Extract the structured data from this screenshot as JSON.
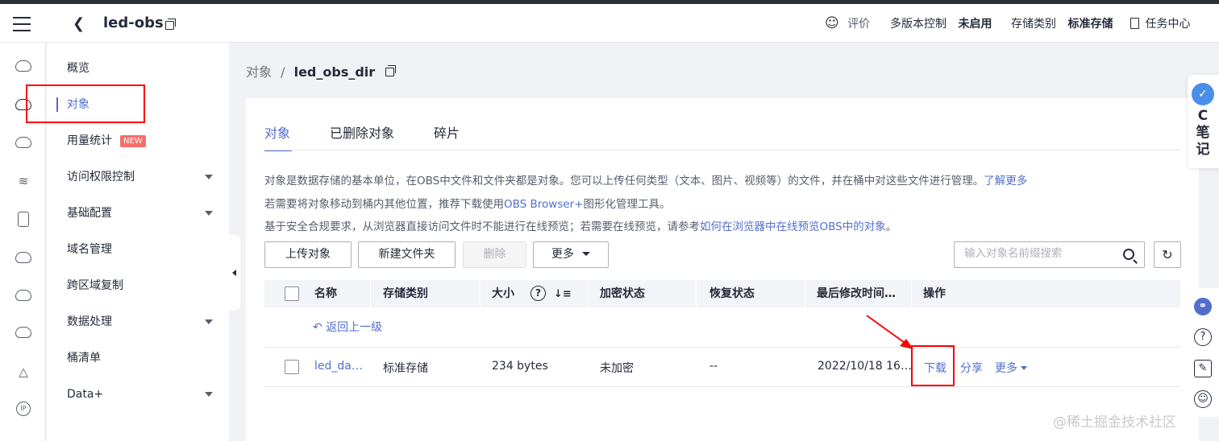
{
  "header": {
    "bucket_name": "led-obs",
    "review_label": "评价",
    "versioning_label": "多版本控制",
    "versioning_value": "未启用",
    "storage_class_label": "存储类别",
    "storage_class_value": "标准存储",
    "task_center_label": "任务中心"
  },
  "sidebar": {
    "items": [
      {
        "label": "概览",
        "dropdown": false
      },
      {
        "label": "对象",
        "dropdown": false,
        "active": true
      },
      {
        "label": "用量统计",
        "badge": "NEW",
        "dropdown": false
      },
      {
        "label": "访问权限控制",
        "dropdown": true
      },
      {
        "label": "基础配置",
        "dropdown": true
      },
      {
        "label": "域名管理",
        "dropdown": false
      },
      {
        "label": "跨区域复制",
        "dropdown": false
      },
      {
        "label": "数据处理",
        "dropdown": true
      },
      {
        "label": "桶清单",
        "dropdown": false
      },
      {
        "label": "Data+",
        "dropdown": true
      }
    ]
  },
  "breadcrumb": {
    "parent": "对象",
    "separator": "/",
    "current": "led_obs_dir"
  },
  "tabs": [
    "对象",
    "已删除对象",
    "碎片"
  ],
  "description": {
    "line1_text": "对象是数据存储的基本单位，在OBS中文件和文件夹都是对象。您可以上传任何类型（文本、图片、视频等）的文件，并在桶中对这些文件进行管理。",
    "line1_link": "了解更多",
    "line2_prefix": "若需要将对象移动到桶内其他位置，推荐下载使用",
    "line2_link": "OBS Browser+",
    "line2_suffix": "图形化管理工具。",
    "line3_prefix": "基于安全合规要求，从浏览器直接访问文件时不能进行在线预览；若需要在线预览，请参考",
    "line3_link": "如何在浏览器中在线预览OBS中的对象",
    "line3_suffix": "。"
  },
  "toolbar": {
    "upload": "上传对象",
    "new_folder": "新建文件夹",
    "delete": "删除",
    "more": "更多",
    "search_placeholder": "输入对象名前缀搜索"
  },
  "table": {
    "headers": [
      "名称",
      "存储类别",
      "大小",
      "加密状态",
      "恢复状态",
      "最后修改时间…",
      "操作"
    ],
    "back_link": "返回上一级",
    "rows": [
      {
        "name": "led_da…",
        "storage_class": "标准存储",
        "size": "234 bytes",
        "encryption": "未加密",
        "restore": "--",
        "modified": "2022/10/18 16…",
        "actions": [
          "下载",
          "分享",
          "更多"
        ]
      }
    ]
  },
  "right_widget": {
    "logo_letter": "C",
    "text_chars": [
      "C",
      "笔",
      "记"
    ]
  },
  "watermark": "@稀土掘金技术社区",
  "colors": {
    "accent": "#526ecc",
    "annotation_red": "#ff0000",
    "new_badge": "#f66f6a"
  }
}
